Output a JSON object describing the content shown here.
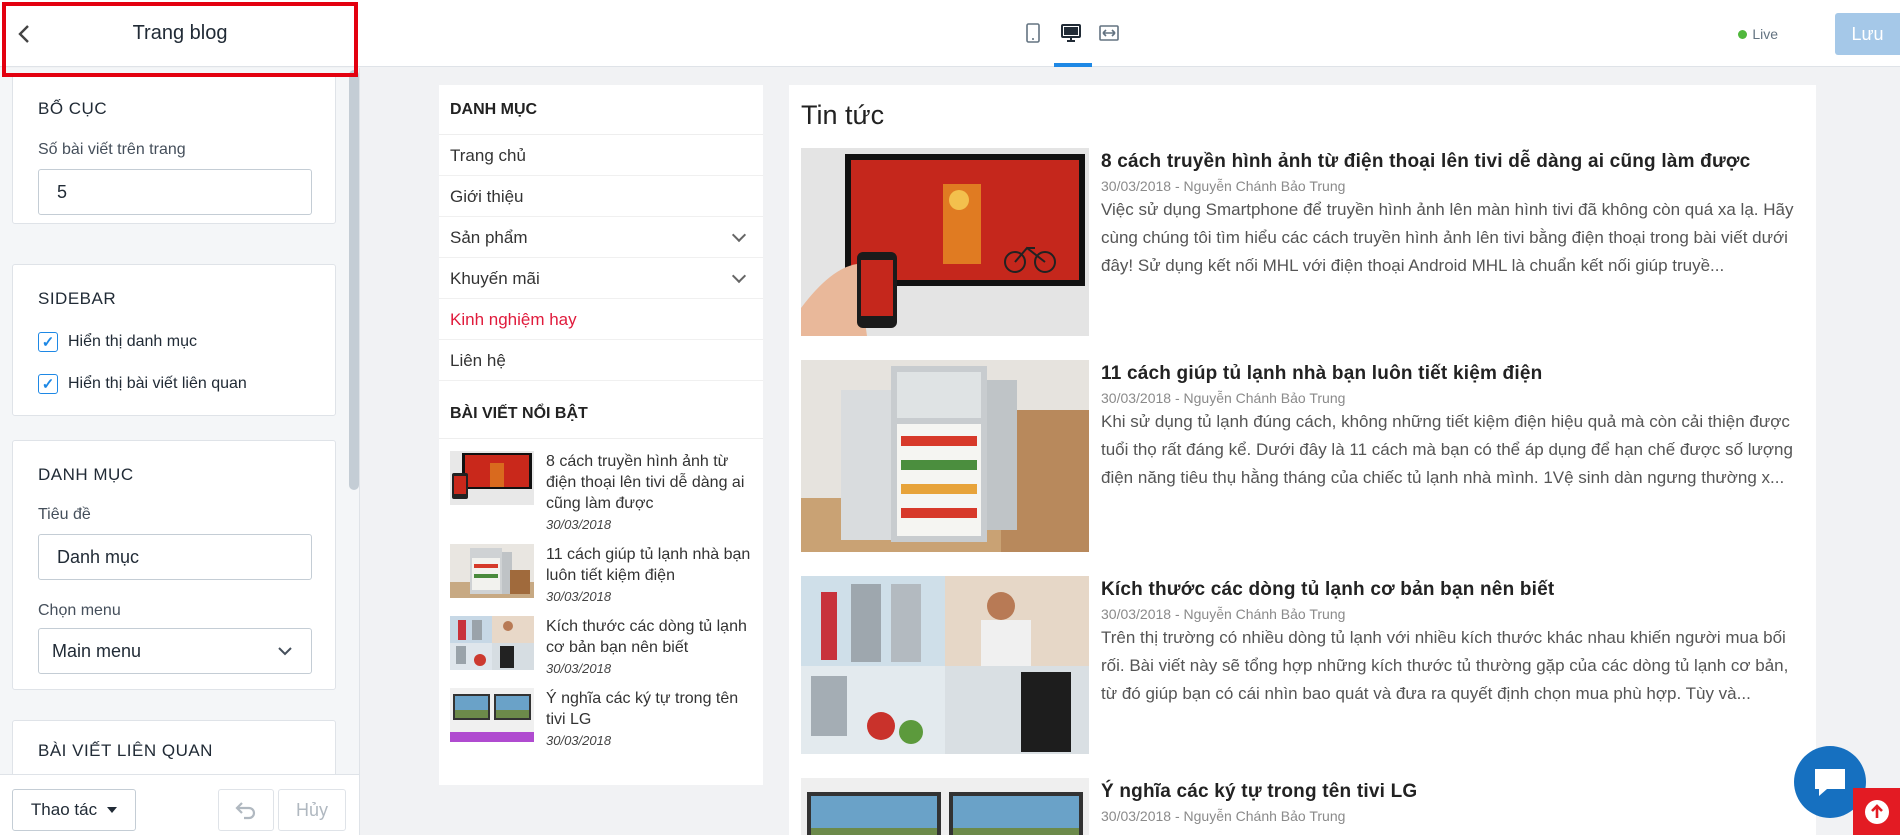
{
  "header": {
    "title": "Trang blog",
    "live_label": "Live",
    "save_label": "Lưu"
  },
  "panel": {
    "layout": {
      "heading": "BỐ CỤC",
      "posts_per_page_label": "Số bài viết trên trang",
      "posts_per_page_value": "5"
    },
    "sidebar": {
      "heading": "SIDEBAR",
      "show_categories_label": "Hiển thị danh mục",
      "show_related_label": "Hiển thị bài viết liên quan"
    },
    "category": {
      "heading": "DANH MỤC",
      "title_label": "Tiêu đề",
      "title_value": "Danh mục",
      "menu_label": "Chọn menu",
      "menu_value": "Main menu"
    },
    "related": {
      "heading": "BÀI VIẾT LIÊN QUAN"
    },
    "footer": {
      "actions_label": "Thao tác",
      "cancel_label": "Hủy"
    }
  },
  "preview": {
    "sidebar": {
      "menu_heading": "DANH MỤC",
      "menu": [
        {
          "label": "Trang chủ"
        },
        {
          "label": "Giới thiệu"
        },
        {
          "label": "Sản phẩm"
        },
        {
          "label": "Khuyến mãi"
        },
        {
          "label": "Kinh nghiệm hay"
        },
        {
          "label": "Liên hệ"
        }
      ],
      "featured_heading": "BÀI VIẾT NỔI BẬT",
      "featured": [
        {
          "title": "8 cách truyền hình ảnh từ điện thoại lên tivi dễ dàng ai cũng làm được",
          "date": "30/03/2018"
        },
        {
          "title": "11 cách giúp tủ lạnh nhà bạn luôn tiết kiệm điện",
          "date": "30/03/2018"
        },
        {
          "title": "Kích thước các dòng tủ lạnh cơ bản bạn nên biết",
          "date": "30/03/2018"
        },
        {
          "title": "Ý nghĩa các ký tự trong tên tivi LG",
          "date": "30/03/2018"
        }
      ]
    },
    "main": {
      "title": "Tin tức",
      "posts": [
        {
          "title": "8 cách truyền hình ảnh từ điện thoại lên tivi dễ dàng ai cũng làm được",
          "meta": "30/03/2018 - Nguyễn Chánh Bảo Trung",
          "excerpt": "Việc sử dụng Smartphone để truyền hình ảnh lên màn hình tivi đã không còn quá xa lạ. Hãy cùng chúng tôi tìm hiểu các cách truyền hình ảnh lên tivi bằng điện thoại trong bài viết dưới đây! Sử dụng kết nối MHL với điện thoại Android MHL là chuẩn kết nối giúp truyề..."
        },
        {
          "title": "11 cách giúp tủ lạnh nhà bạn luôn tiết kiệm điện",
          "meta": "30/03/2018 - Nguyễn Chánh Bảo Trung",
          "excerpt": "Khi sử dụng tủ lạnh đúng cách, không những tiết kiệm điện hiệu quả mà còn cải thiện được tuổi thọ rất đáng kể. Dưới đây là 11 cách mà bạn có thể áp dụng để hạn chế được số lượng điện năng tiêu thụ hằng tháng của chiếc tủ lạnh nhà mình. 1Vệ sinh dàn ngưng thường x..."
        },
        {
          "title": "Kích thước các dòng tủ lạnh cơ bản bạn nên biết",
          "meta": "30/03/2018 - Nguyễn Chánh Bảo Trung",
          "excerpt": "Trên thị trường có nhiều dòng tủ lạnh với nhiều kích thước khác nhau khiến người mua bối rối. Bài viết này sẽ tổng hợp những kích thước tủ thường gặp của các dòng tủ lạnh cơ bản, từ đó giúp bạn có cái nhìn bao quát và đưa ra quyết định chọn mua phù hợp. Tùy và..."
        },
        {
          "title": "Ý nghĩa các ký tự trong tên tivi LG",
          "meta": "30/03/2018 - Nguyễn Chánh Bảo Trung",
          "excerpt": ""
        }
      ]
    }
  },
  "colors": {
    "accent": "#1e88e5",
    "active_link": "#e01b3c",
    "save_button": "#a5c8e8",
    "live_dot": "#50b83c",
    "highlight_box": "#e3000f"
  }
}
